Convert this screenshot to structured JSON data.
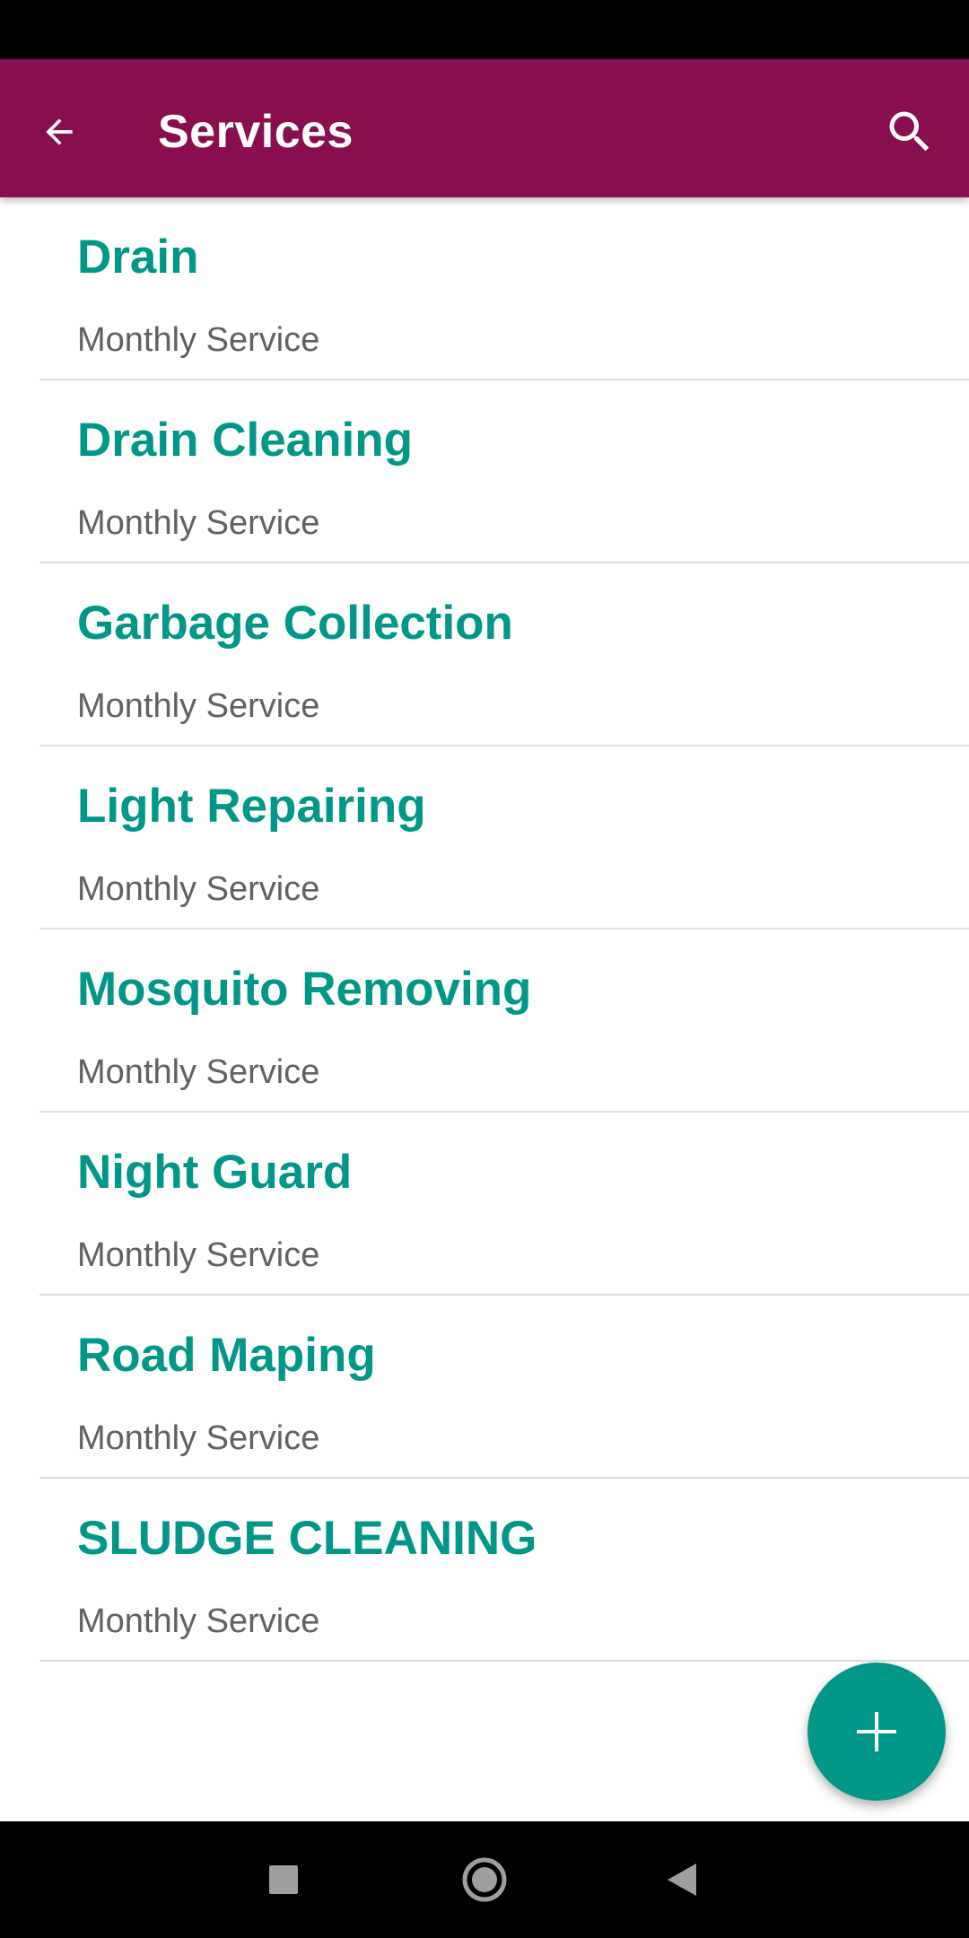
{
  "app_bar": {
    "title": "Services",
    "background_color": "#880e4f",
    "back_icon": "arrow-back-icon",
    "search_icon": "search-icon"
  },
  "accent_color": "#009688",
  "services": [
    {
      "name": "Drain",
      "type": "Monthly Service"
    },
    {
      "name": "Drain Cleaning",
      "type": "Monthly Service"
    },
    {
      "name": "Garbage Collection",
      "type": "Monthly Service"
    },
    {
      "name": "Light Repairing",
      "type": "Monthly Service"
    },
    {
      "name": "Mosquito Removing",
      "type": "Monthly Service"
    },
    {
      "name": "Night Guard",
      "type": "Monthly Service"
    },
    {
      "name": "Road Maping",
      "type": "Monthly Service"
    },
    {
      "name": "SLUDGE CLEANING",
      "type": "Monthly Service"
    }
  ],
  "fab": {
    "icon": "plus-icon"
  },
  "nav_bar": {
    "recents_icon": "square-icon",
    "home_icon": "circle-icon",
    "back_icon": "triangle-back-icon"
  }
}
